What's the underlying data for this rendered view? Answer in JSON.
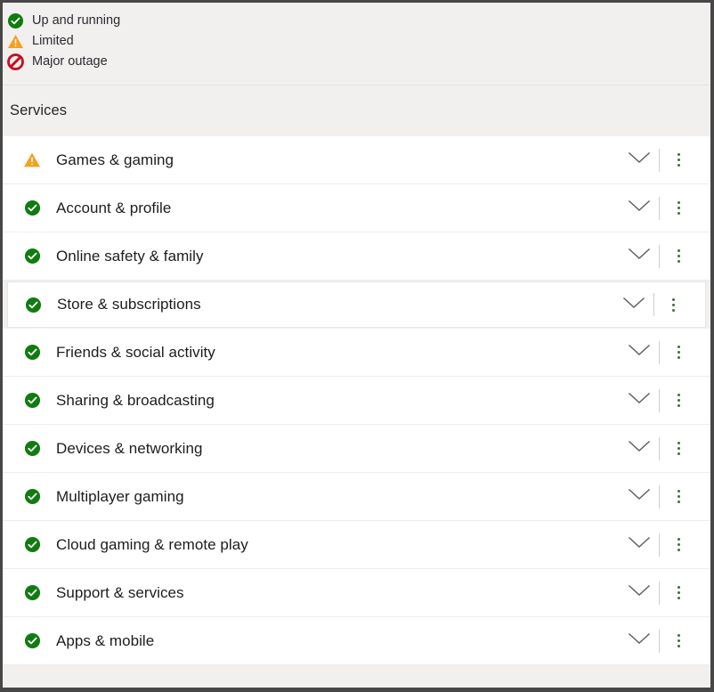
{
  "legend": {
    "items": [
      {
        "label": "Up and running",
        "icon": "check-circle-icon",
        "color": "#107c10"
      },
      {
        "label": "Limited",
        "icon": "warning-triangle-icon",
        "color": "#f7a01c"
      },
      {
        "label": "Major outage",
        "icon": "prohibition-icon",
        "color": "#c50f1f"
      }
    ]
  },
  "services_section": {
    "title": "Services",
    "row_chevron_icon": "chevron-down-icon",
    "row_menu_icon": "kebab-menu-icon",
    "rows": [
      {
        "name": "Games & gaming",
        "status": "limited",
        "icon": "warning-triangle-icon",
        "active": false
      },
      {
        "name": "Account & profile",
        "status": "up-and-running",
        "icon": "check-circle-icon",
        "active": false
      },
      {
        "name": "Online safety & family",
        "status": "up-and-running",
        "icon": "check-circle-icon",
        "active": false
      },
      {
        "name": "Store & subscriptions",
        "status": "up-and-running",
        "icon": "check-circle-icon",
        "active": true
      },
      {
        "name": "Friends & social activity",
        "status": "up-and-running",
        "icon": "check-circle-icon",
        "active": false
      },
      {
        "name": "Sharing & broadcasting",
        "status": "up-and-running",
        "icon": "check-circle-icon",
        "active": false
      },
      {
        "name": "Devices & networking",
        "status": "up-and-running",
        "icon": "check-circle-icon",
        "active": false
      },
      {
        "name": "Multiplayer gaming",
        "status": "up-and-running",
        "icon": "check-circle-icon",
        "active": false
      },
      {
        "name": "Cloud gaming & remote play",
        "status": "up-and-running",
        "icon": "check-circle-icon",
        "active": false
      },
      {
        "name": "Support & services",
        "status": "up-and-running",
        "icon": "check-circle-icon",
        "active": false
      },
      {
        "name": "Apps & mobile",
        "status": "up-and-running",
        "icon": "check-circle-icon",
        "active": false
      }
    ]
  },
  "colors": {
    "up_and_running": "#107c10",
    "limited": "#f7a01c",
    "major_outage": "#c50f1f",
    "page_background": "#f1f0ee",
    "row_background": "#ffffff",
    "text": "#1d1d20",
    "frame_border": "#474747"
  }
}
